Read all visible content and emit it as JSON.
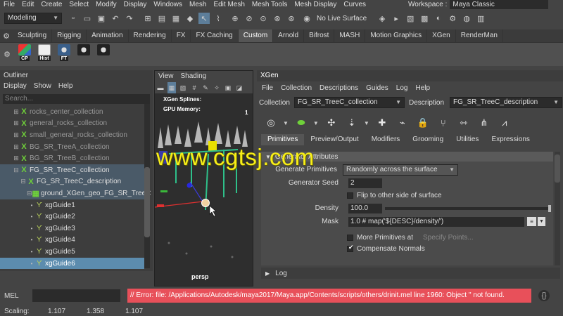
{
  "menubar": {
    "items": [
      "File",
      "Edit",
      "Create",
      "Select",
      "Modify",
      "Display",
      "Windows",
      "Mesh",
      "Edit Mesh",
      "Mesh Tools",
      "Mesh Display",
      "Curves"
    ],
    "workspace_label": "Workspace :",
    "workspace_value": "Maya Classic"
  },
  "statusline": {
    "mode": "Modeling",
    "live_surface": "No Live Surface"
  },
  "shelf": {
    "tabs": [
      "Sculpting",
      "Rigging",
      "Animation",
      "Rendering",
      "FX",
      "FX Caching",
      "Custom",
      "Arnold",
      "Bifrost",
      "MASH",
      "Motion Graphics",
      "XGen",
      "RenderMan"
    ],
    "active_tab": "Custom",
    "buttons": [
      {
        "label": "CP",
        "icon": "cp-shelf-icon"
      },
      {
        "label": "Hist",
        "icon": "hist-shelf-icon"
      },
      {
        "label": "FT",
        "icon": "ft-shelf-icon"
      }
    ]
  },
  "outliner": {
    "title": "Outliner",
    "menu": [
      "Display",
      "Show",
      "Help"
    ],
    "search_placeholder": "Search...",
    "items": [
      {
        "label": "rocks_center_collection"
      },
      {
        "label": "general_rocks_collection"
      },
      {
        "label": "small_general_rocks_collection"
      },
      {
        "label": "BG_SR_TreeA_collection"
      },
      {
        "label": "BG_SR_TreeB_collection"
      },
      {
        "label": "FG_SR_TreeC_collection"
      },
      {
        "label": "FG_SR_TreeC_description"
      },
      {
        "label": "ground_XGen_geo_FG_SR_TreeC"
      },
      {
        "label": "xgGuide1"
      },
      {
        "label": "xgGuide2"
      },
      {
        "label": "xgGuide3"
      },
      {
        "label": "xgGuide4"
      },
      {
        "label": "xgGuide5"
      },
      {
        "label": "xgGuide6"
      }
    ]
  },
  "viewport": {
    "menu": [
      "View",
      "Shading"
    ],
    "hud_line1": "XGen Splines:",
    "hud_line2": "GPU Memory:",
    "hud_value": "1",
    "camera": "persp"
  },
  "xgen": {
    "title": "XGen",
    "menu": [
      "File",
      "Collection",
      "Descriptions",
      "Guides",
      "Log",
      "Help"
    ],
    "collection_label": "Collection",
    "collection_value": "FG_SR_TreeC_collection",
    "description_label": "Description",
    "description_value": "FG_SR_TreeC_description",
    "tabs": [
      "Primitives",
      "Preview/Output",
      "Modifiers",
      "Grooming",
      "Utilities",
      "Expressions"
    ],
    "active_tab": "Primitives",
    "section_header": "Generator Attributes",
    "fields": {
      "generate_primitives_label": "Generate Primitives",
      "generate_primitives_value": "Randomly across the surface",
      "generator_seed_label": "Generator Seed",
      "generator_seed_value": "2",
      "flip_label": "Flip to other side of surface",
      "density_label": "Density",
      "density_value": "100.0",
      "mask_label": "Mask",
      "mask_value": "1.0 # map('${DESC}/density/')",
      "more_primitives_label": "More Primitives at",
      "specify_points_label": "Specify Points...",
      "compensate_normals_label": "Compensate Normals"
    },
    "log_label": "Log"
  },
  "cmdline": {
    "label": "MEL",
    "error": "// Error: file: /Applications/Autodesk/maya2017/Maya.app/Contents/scripts/others/drinit.mel line 1960: Object '' not found."
  },
  "helpline": {
    "label": "Scaling:",
    "v1": "1.107",
    "v2": "1.358",
    "v3": "1.107"
  },
  "watermark": "www.cgtsj.com",
  "colors": {
    "accent": "#5c8cae",
    "error_bg": "#e8505a",
    "xgen_green": "#6fd13a",
    "watermark": "#f7ee18"
  }
}
